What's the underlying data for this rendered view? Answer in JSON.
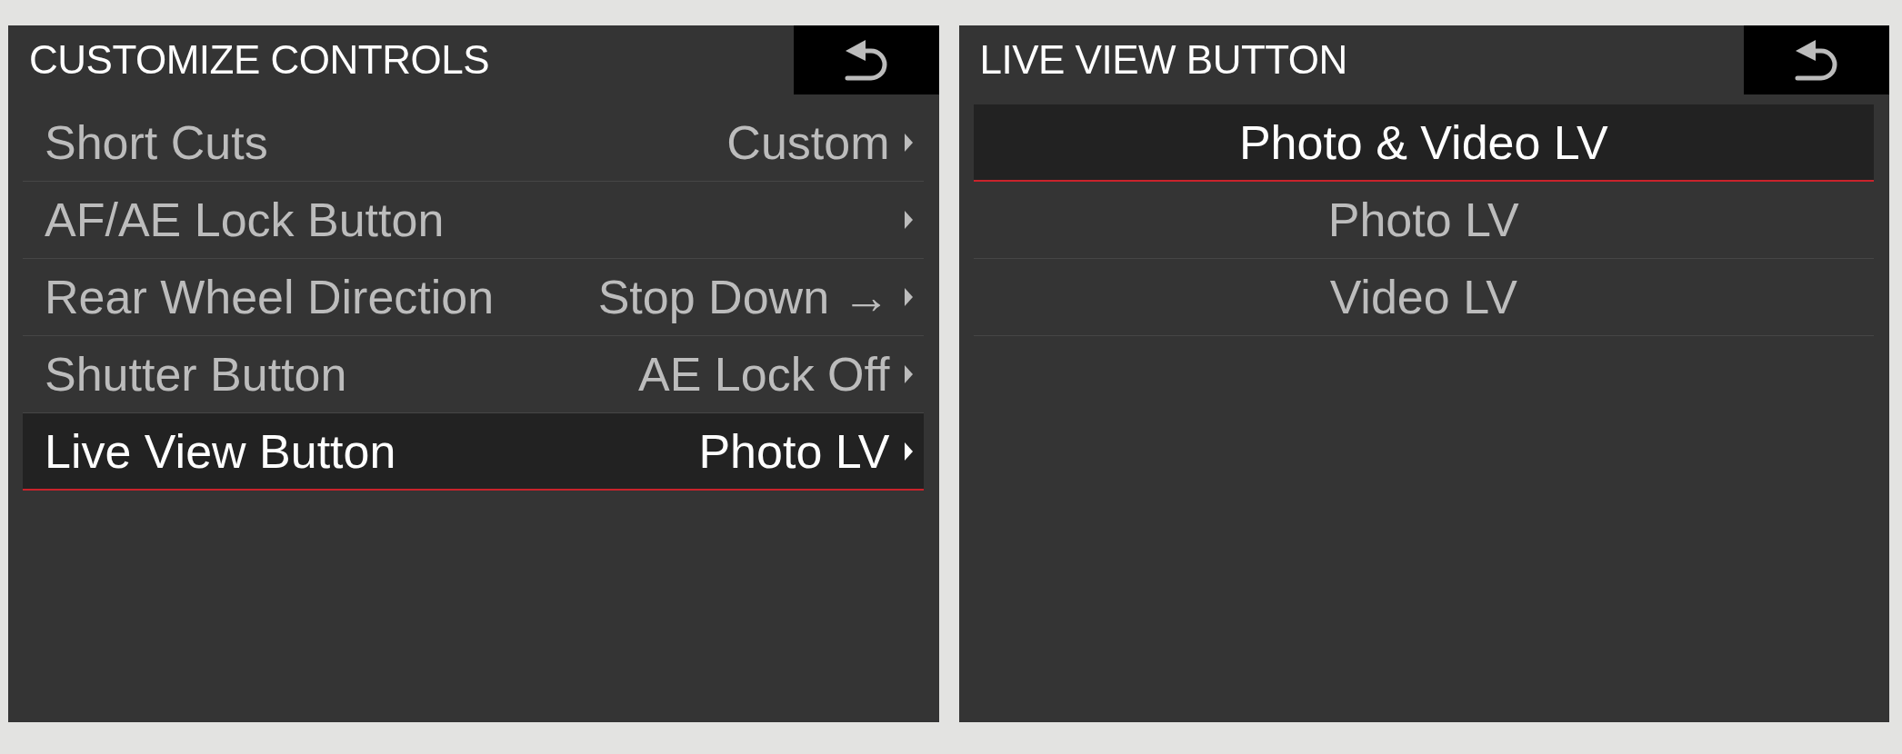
{
  "screens": [
    {
      "kind": "menu",
      "title": "CUSTOMIZE CONTROLS",
      "rows": [
        {
          "label": "Short Cuts",
          "value": "Custom",
          "selected": false
        },
        {
          "label": "AF/AE Lock Button",
          "selected": false
        },
        {
          "label": "Rear Wheel Direction",
          "value": "Stop Down →",
          "selected": false
        },
        {
          "label": "Shutter Button",
          "value": "AE Lock Off",
          "selected": false
        },
        {
          "label": "Live View Button",
          "value": "Photo LV",
          "selected": true
        }
      ]
    },
    {
      "kind": "options",
      "title": "LIVE VIEW BUTTON",
      "rows": [
        {
          "label": "Photo & Video LV",
          "selected": true
        },
        {
          "label": "Photo LV",
          "selected": false
        },
        {
          "label": "Video LV",
          "selected": false
        }
      ]
    }
  ]
}
